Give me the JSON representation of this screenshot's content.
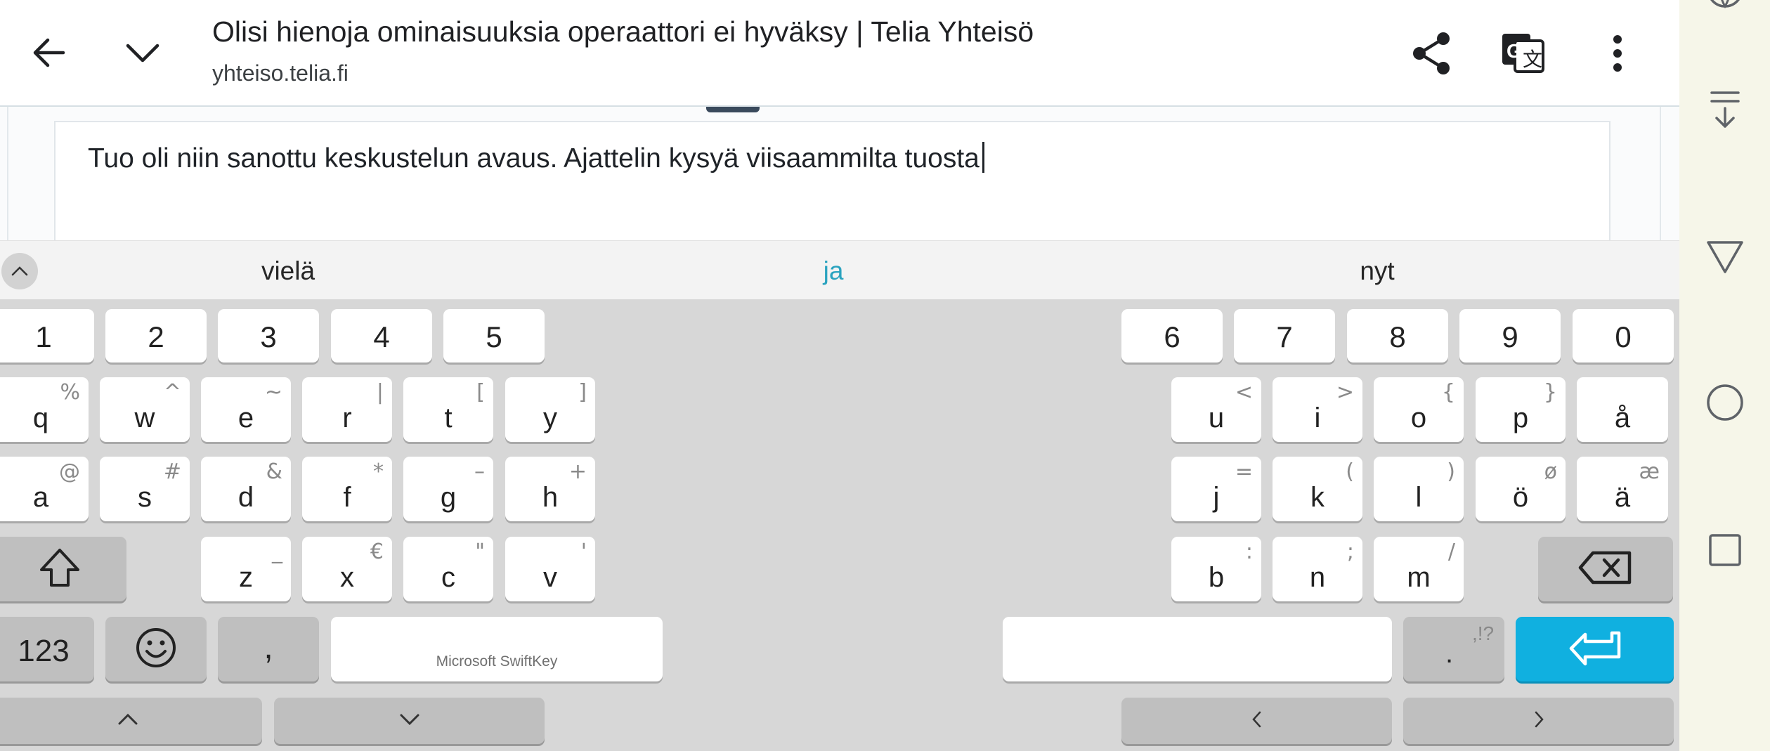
{
  "browser": {
    "page_title": "Olisi hienoja ominaisuuksia operaattori ei hyväksy | Telia Yhteisö",
    "page_url": "yhteiso.telia.fi"
  },
  "editor": {
    "text": "Tuo oli niin sanottu keskustelun avaus. Ajattelin kysyä viisaammilta tuosta"
  },
  "suggestions": [
    "vielä",
    "ja",
    "nyt"
  ],
  "keyboard": {
    "brand": "Microsoft SwiftKey",
    "numbers_left": [
      "1",
      "2",
      "3",
      "4",
      "5"
    ],
    "numbers_right": [
      "6",
      "7",
      "8",
      "9",
      "0"
    ],
    "row1_left": [
      {
        "main": "q",
        "sub": "%"
      },
      {
        "main": "w",
        "sub": "^"
      },
      {
        "main": "e",
        "sub": "~"
      },
      {
        "main": "r",
        "sub": "|"
      },
      {
        "main": "t",
        "sub": "["
      },
      {
        "main": "y",
        "sub": "]"
      }
    ],
    "row1_right": [
      {
        "main": "u",
        "sub": "<"
      },
      {
        "main": "i",
        "sub": ">"
      },
      {
        "main": "o",
        "sub": "{"
      },
      {
        "main": "p",
        "sub": "}"
      },
      {
        "main": "å",
        "sub": ""
      }
    ],
    "row2_left": [
      {
        "main": "a",
        "sub": "@"
      },
      {
        "main": "s",
        "sub": "#"
      },
      {
        "main": "d",
        "sub": "&"
      },
      {
        "main": "f",
        "sub": "*"
      },
      {
        "main": "g",
        "sub": "–"
      },
      {
        "main": "h",
        "sub": "+"
      }
    ],
    "row2_right": [
      {
        "main": "j",
        "sub": "="
      },
      {
        "main": "k",
        "sub": "("
      },
      {
        "main": "l",
        "sub": ")"
      },
      {
        "main": "ö",
        "sub": "ø"
      },
      {
        "main": "ä",
        "sub": "æ"
      }
    ],
    "row3_left": [
      {
        "main": "z",
        "sub": "_"
      },
      {
        "main": "x",
        "sub": "€"
      },
      {
        "main": "c",
        "sub": "\""
      },
      {
        "main": "v",
        "sub": "'"
      }
    ],
    "row3_right": [
      {
        "main": "b",
        "sub": ":"
      },
      {
        "main": "n",
        "sub": ";"
      },
      {
        "main": "m",
        "sub": "/"
      }
    ],
    "key_123": "123",
    "key_comma": ",",
    "key_period": ".",
    "key_period_sub": ",!?"
  },
  "icons": {
    "back": "arrow-left-icon",
    "collapse": "chevron-down-icon",
    "share": "share-icon",
    "translate": "google-translate-icon",
    "more": "more-vert-icon",
    "shift": "shift-icon",
    "backspace": "backspace-icon",
    "emoji": "emoji-icon",
    "enter": "enter-icon"
  },
  "colors": {
    "suggestion_highlight": "#2aa3bf",
    "enter_key": "#10b0e0"
  }
}
